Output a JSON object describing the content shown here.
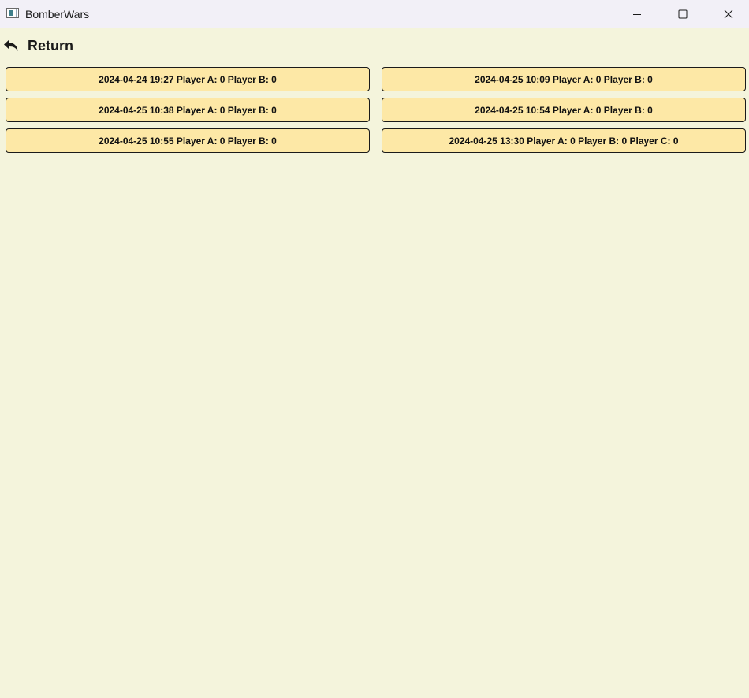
{
  "window": {
    "title": "BomberWars",
    "icon": "app-window-icon",
    "controls": {
      "minimize_icon": "minimize-icon",
      "maximize_icon": "maximize-icon",
      "close_icon": "close-icon"
    }
  },
  "nav": {
    "return_label": "Return",
    "return_icon": "return-arrow-icon"
  },
  "saved_games": [
    {
      "label": "2024-04-24 19:27 Player A: 0 Player B: 0"
    },
    {
      "label": "2024-04-25 10:09 Player A: 0 Player B: 0"
    },
    {
      "label": "2024-04-25 10:38 Player A: 0 Player B: 0"
    },
    {
      "label": "2024-04-25 10:54 Player A: 0 Player B: 0"
    },
    {
      "label": "2024-04-25 10:55 Player A: 0 Player B: 0"
    },
    {
      "label": "2024-04-25 13:30 Player A: 0 Player B: 0 Player C: 0"
    }
  ],
  "colors": {
    "background": "#f4f4dc",
    "titlebar": "#f2f0f7",
    "button_fill": "#fde8a6",
    "button_border": "#1a1a1a"
  }
}
